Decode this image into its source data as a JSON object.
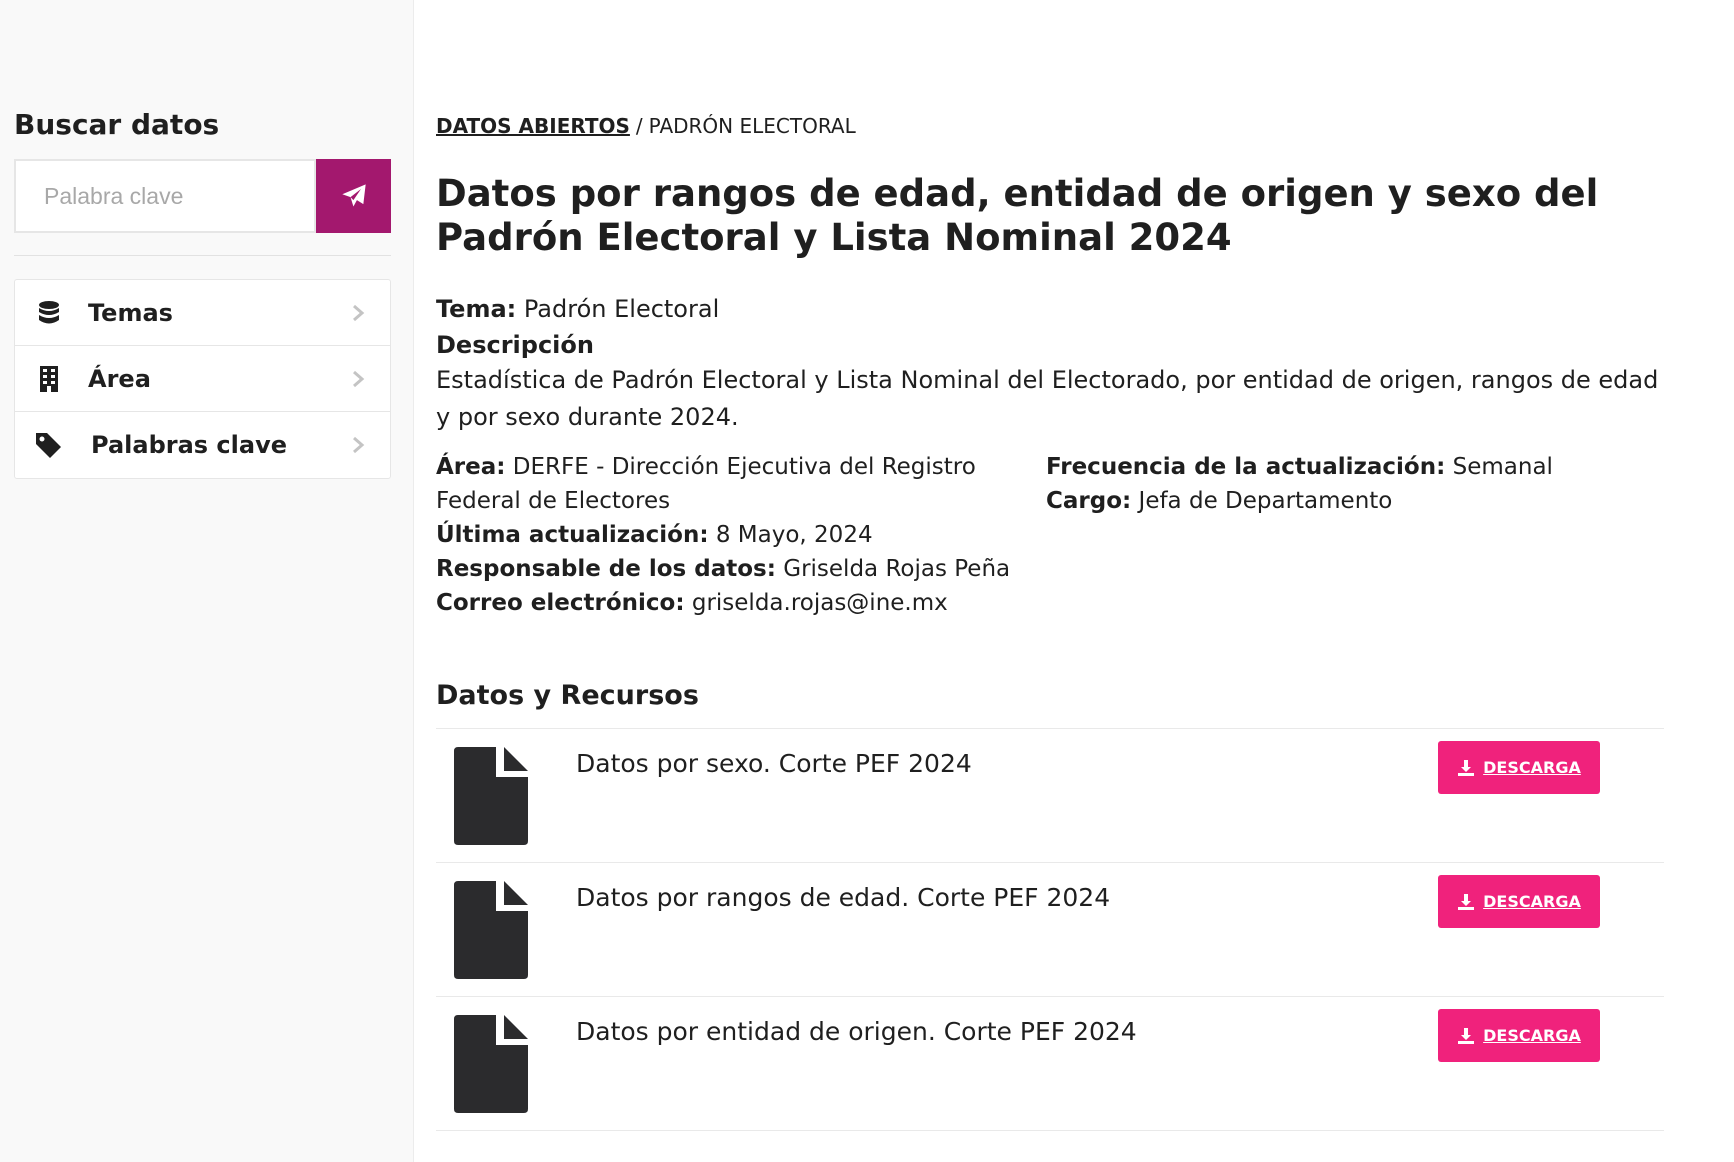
{
  "sidebar": {
    "title": "Buscar datos",
    "search": {
      "placeholder": "Palabra clave",
      "value": ""
    },
    "menu": [
      {
        "label": "Temas",
        "icon": "database-icon"
      },
      {
        "label": "Área",
        "icon": "building-icon"
      },
      {
        "label": "Palabras clave",
        "icon": "tag-icon"
      }
    ]
  },
  "breadcrumb": {
    "root": "DATOS ABIERTOS",
    "separator": "/",
    "current": "PADRÓN ELECTORAL"
  },
  "dataset": {
    "title": "Datos por rangos de edad, entidad de origen y sexo del Padrón Electoral y Lista Nominal 2024",
    "tema_label": "Tema:",
    "tema": "Padrón Electoral",
    "descripcion_label": "Descripción",
    "descripcion": "Estadística de Padrón Electoral y Lista Nominal del Electorado, por entidad de origen, rangos de edad y por sexo durante 2024.",
    "area_label": "Área:",
    "area": "DERFE - Dirección Ejecutiva del Registro Federal de Electores",
    "frecuencia_label": "Frecuencia de la actualización:",
    "frecuencia": "Semanal",
    "cargo_label": "Cargo:",
    "cargo": "Jefa de Departamento",
    "ultima_label": "Última actualización:",
    "ultima": "8 Mayo, 2024",
    "responsable_label": "Responsable de los datos:",
    "responsable": "Griselda Rojas Peña",
    "correo_label": "Correo electrónico:",
    "correo": "griselda.rojas@ine.mx"
  },
  "resources_section": {
    "title": "Datos y Recursos",
    "items": [
      {
        "name": "Datos por sexo. Corte PEF 2024",
        "button": "DESCARGA"
      },
      {
        "name": "Datos por rangos de edad. Corte PEF 2024",
        "button": "DESCARGA"
      },
      {
        "name": "Datos por entidad de origen. Corte PEF 2024",
        "button": "DESCARGA"
      }
    ]
  },
  "colors": {
    "search_button": "#a3186e",
    "download_button": "#f0227c",
    "text": "#1f1f1f"
  }
}
